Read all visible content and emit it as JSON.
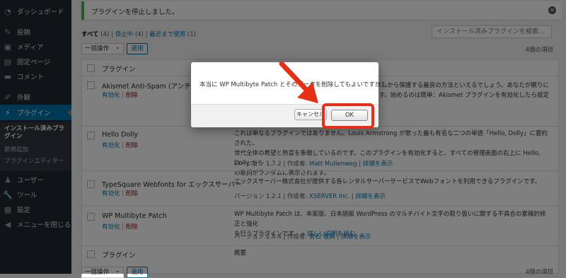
{
  "colors": {
    "accent": "#0073aa",
    "sidebar_bg": "#23282d",
    "highlight": "#e53017",
    "notice_border": "#46b450",
    "delete": "#a00"
  },
  "sidebar": {
    "items": [
      {
        "label": "ダッシュボード",
        "icon": "gauge-icon"
      },
      {
        "label": "投稿",
        "icon": "pin-icon"
      },
      {
        "label": "メディア",
        "icon": "media-icon"
      },
      {
        "label": "固定ページ",
        "icon": "page-icon"
      },
      {
        "label": "コメント",
        "icon": "comment-icon"
      },
      {
        "label": "外観",
        "icon": "brush-icon"
      },
      {
        "label": "プラグイン",
        "icon": "plugin-icon"
      },
      {
        "label": "ユーザー",
        "icon": "user-icon"
      },
      {
        "label": "ツール",
        "icon": "wrench-icon"
      },
      {
        "label": "設定",
        "icon": "settings-icon"
      },
      {
        "label": "メニューを閉じる",
        "icon": "collapse-icon"
      }
    ],
    "submenu": [
      {
        "label": "インストール済みプラグイン"
      },
      {
        "label": "新規追加"
      },
      {
        "label": "プラグインエディター"
      }
    ]
  },
  "notice": {
    "text": "プラグインを停止しました。"
  },
  "filters": {
    "all": "すべて",
    "all_count": "(4)",
    "inactive": "停止中",
    "inactive_count": "(4)",
    "recent": "最近まで使用",
    "recent_count": "(1)",
    "sep": "|"
  },
  "search": {
    "placeholder": "インストール済みプラグインを検索..."
  },
  "bulk": {
    "label": "一括操作",
    "apply": "適用"
  },
  "items_count": "4個の項目",
  "table": {
    "header": {
      "plugin": "プラグイン"
    },
    "footer": {
      "plugin": "プラグイン",
      "description": "概要"
    },
    "action_activate": "有効化",
    "action_delete": "削除",
    "action_sep": "|",
    "rows": [
      {
        "name": "Akismet Anti-Spam (アンチスパ",
        "desc": [
          "スパムから保護する最良の方法といえるでしょう。あなたが眠りに",
          "ます。始めるのは簡単：Akismet プラグインを有効化したら設定"
        ],
        "meta": ""
      },
      {
        "name": "Hello Dolly",
        "desc": [
          "これは単なるプラグインではありません。Louis Armstrong が歌った最も有名な二つの単語「Hello, Dolly」に要約された、",
          "世代全体の希望と熱意を象徴しているのです。このプラグインを有効化すると、すべての管理画面の右上に Hello, Dolly から",
          "の歌詞がランダムに表示されます。"
        ],
        "meta_prefix": "バージョン 1.7.2 | 作成者: ",
        "meta_author": "Matt Mullenweg",
        "meta_sep": " | ",
        "meta_link": "詳細を表示"
      },
      {
        "name": "TypeSquare Webfonts for エックスサーバー",
        "desc": [
          "エックスサーバー株式会社が提供する各レンタルサーバーサービスでWebフォントを利用できるプラグインです。"
        ],
        "meta_prefix": "バージョン 1.2.1 | 作成者: ",
        "meta_author": "XSERVER Inc.",
        "meta_sep": " | ",
        "meta_link": "詳細を表示"
      },
      {
        "name": "WP Multibyte Patch",
        "desc": [
          "WP Multibyte Patch は、本家版、日本語版 WordPress のマルチバイト文字の取り扱いに関する不具合の累積的修正と強化",
          "を行うプラグインです。"
        ],
        "desc_link": "» 詳しい説明を読む",
        "meta_prefix": "バージョン 2.8.4 | 作成者: ",
        "meta_author": "倉石 敬典",
        "meta_sep": " | ",
        "meta_link": "詳細を表示"
      }
    ]
  },
  "dialog": {
    "message": "本当に WP Multibyte Patch とそのデータを削除してもよいですか？",
    "cancel": "キャンセル",
    "ok": "OK"
  },
  "bottom_bulk": {
    "label": "一括操作",
    "apply": "適用",
    "items_count": "4個の項目"
  }
}
